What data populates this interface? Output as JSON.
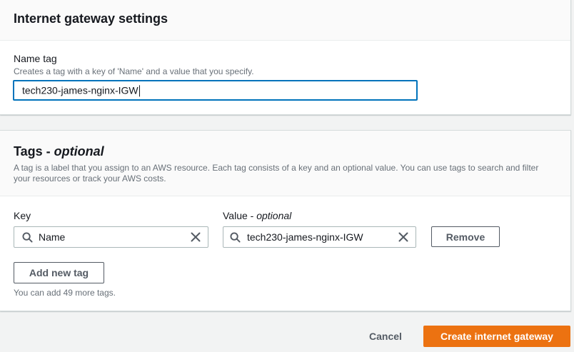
{
  "gateway_settings": {
    "title": "Internet gateway settings",
    "name_tag": {
      "label": "Name tag",
      "description": "Creates a tag with a key of 'Name' and a value that you specify.",
      "value": "tech230-james-nginx-IGW"
    }
  },
  "tags": {
    "title": "Tags - ",
    "title_optional": "optional",
    "description": "A tag is a label that you assign to an AWS resource. Each tag consists of a key and an optional value. You can use tags to search and filter your resources or track your AWS costs.",
    "key_label": "Key",
    "value_label": "Value - ",
    "value_label_optional": "optional",
    "rows": [
      {
        "key": "Name",
        "value": "tech230-james-nginx-IGW",
        "remove_label": "Remove"
      }
    ],
    "add_label": "Add new tag",
    "limit_text": "You can add 49 more tags."
  },
  "footer": {
    "cancel_label": "Cancel",
    "create_label": "Create internet gateway"
  },
  "icons": {
    "search": "search-icon",
    "clear": "close-icon"
  },
  "colors": {
    "primary": "#ec7211",
    "focus": "#0073bb"
  }
}
